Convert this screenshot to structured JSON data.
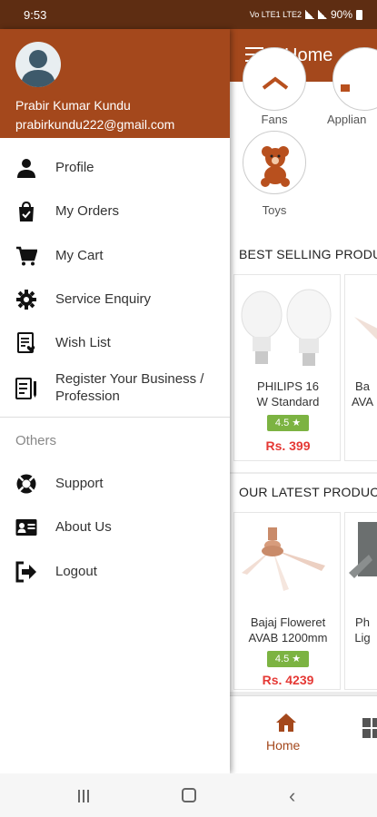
{
  "status_bar": {
    "time": "9:53",
    "indicators": "Vo LTE1 LTE2",
    "battery": "90%"
  },
  "app": {
    "title": "Home",
    "categories": [
      {
        "label": "Fans",
        "icon": "fan-icon"
      },
      {
        "label": "Applian",
        "icon": "appliance-icon"
      },
      {
        "label": "Toys",
        "icon": "teddy-bear-icon"
      }
    ],
    "best_selling": {
      "title": "BEST SELLING PRODU",
      "products": [
        {
          "name_line1": "PHILIPS 16",
          "name_line2": "W Standard",
          "rating": "4.5 ★",
          "price": "Rs. 399"
        },
        {
          "name_line1": "Ba",
          "name_line2": "AVA",
          "rating": "",
          "price": ""
        }
      ]
    },
    "latest": {
      "title": "OUR LATEST PRODUC",
      "products": [
        {
          "name_line1": "Bajaj Floweret",
          "name_line2": "AVAB 1200mm",
          "rating": "4.5 ★",
          "price": "Rs. 4239"
        },
        {
          "name_line1": "Ph",
          "name_line2": "Lig",
          "rating": "",
          "price": ""
        }
      ]
    },
    "bottom_nav": {
      "home_label": "Home"
    }
  },
  "drawer": {
    "user_name": "Prabir Kumar Kundu",
    "user_email": "prabirkundu222@gmail.com",
    "items": [
      {
        "label": "Profile",
        "icon": "person-icon"
      },
      {
        "label": "My Orders",
        "icon": "shopping-bag-icon"
      },
      {
        "label": "My Cart",
        "icon": "cart-icon"
      },
      {
        "label": "Service Enquiry",
        "icon": "gear-icon"
      },
      {
        "label": "Wish List",
        "icon": "wishlist-icon"
      },
      {
        "label": "Register Your Business / Profession",
        "icon": "register-icon"
      }
    ],
    "others_label": "Others",
    "others_items": [
      {
        "label": "Support",
        "icon": "lifebuoy-icon"
      },
      {
        "label": "About Us",
        "icon": "id-card-icon"
      },
      {
        "label": "Logout",
        "icon": "logout-icon"
      }
    ]
  },
  "colors": {
    "primary": "#a4481c",
    "status_bar": "#5e2d12",
    "price": "#e53935",
    "rating": "#7cb342"
  }
}
